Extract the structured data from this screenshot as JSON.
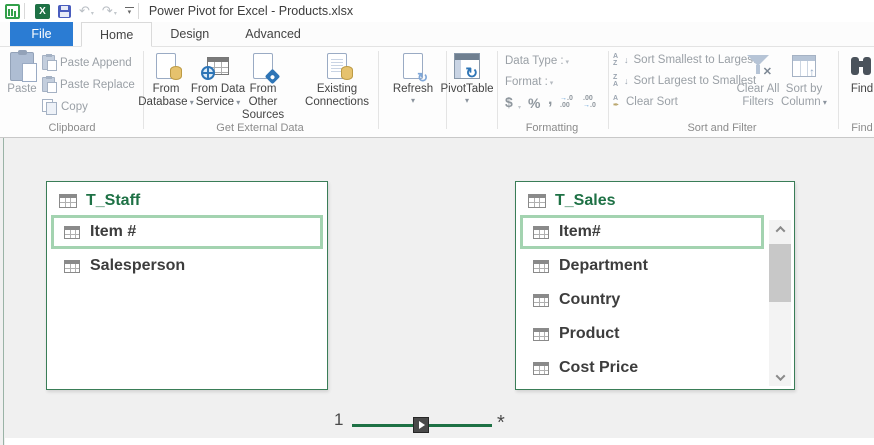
{
  "titlebar": {
    "title": "Power Pivot for Excel - Products.xlsx"
  },
  "tabs": {
    "file": "File",
    "home": "Home",
    "design": "Design",
    "advanced": "Advanced"
  },
  "ribbon": {
    "clipboard": {
      "group_label": "Clipboard",
      "paste": "Paste",
      "paste_append": "Paste Append",
      "paste_replace": "Paste Replace",
      "copy": "Copy"
    },
    "get_external_data": {
      "group_label": "Get External Data",
      "from_database": "From Database",
      "from_data_service": "From Data Service",
      "from_other_sources": "From Other Sources",
      "existing_connections": "Existing Connections"
    },
    "refresh": "Refresh",
    "pivottable": "PivotTable",
    "formatting": {
      "group_label": "Formatting",
      "data_type": "Data Type :",
      "format": "Format :",
      "currency": "$",
      "percent": "%",
      "thousands": ",",
      "increase_decimal_top": ".0",
      "increase_decimal_bottom": ".00",
      "decrease_decimal_top": ".00",
      "decrease_decimal_bottom": ".0"
    },
    "sort_filter": {
      "group_label": "Sort and Filter",
      "sort_smallest": "Sort Smallest to Largest",
      "sort_largest": "Sort Largest to Smallest",
      "clear_sort": "Clear Sort",
      "clear_all_filters": "Clear All Filters",
      "sort_by_column": "Sort by Column"
    },
    "find": {
      "group_label": "Find",
      "button": "Find"
    }
  },
  "diagram": {
    "tables": [
      {
        "name": "T_Staff",
        "fields": [
          {
            "label": "Item #"
          },
          {
            "label": "Salesperson"
          }
        ]
      },
      {
        "name": "T_Sales",
        "fields": [
          {
            "label": "Item#"
          },
          {
            "label": "Department"
          },
          {
            "label": "Country"
          },
          {
            "label": "Product"
          },
          {
            "label": "Cost Price"
          }
        ]
      }
    ],
    "relationship": {
      "one": "1",
      "many": "*"
    }
  },
  "colors": {
    "accent_green": "#217346",
    "file_tab_blue": "#2b7cd3",
    "selection_green": "#a3d3b0",
    "relationship_line": "#1e7145"
  }
}
